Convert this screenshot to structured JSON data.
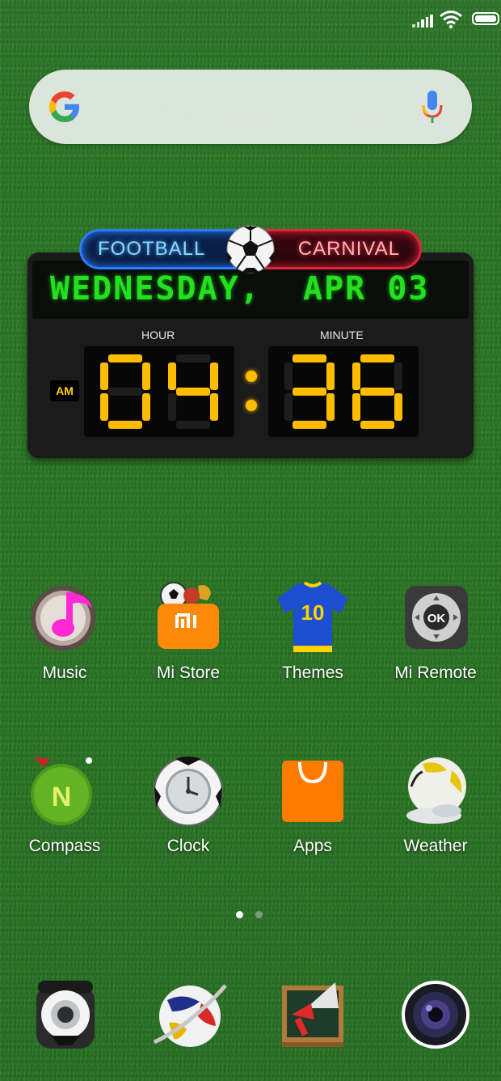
{
  "widget": {
    "banner_left": "FOOTBALL",
    "banner_right": "CARNIVAL",
    "date": "WEDNESDAY,  APR 03",
    "hour_label": "HOUR",
    "minute_label": "MINUTE",
    "ampm": "AM",
    "hour": "04",
    "minute": "36"
  },
  "apps_row1": [
    {
      "label": "Music",
      "icon": "music-icon"
    },
    {
      "label": "Mi Store",
      "icon": "mi-store-icon"
    },
    {
      "label": "Themes",
      "icon": "themes-jersey-icon"
    },
    {
      "label": "Mi Remote",
      "icon": "remote-ok-icon"
    }
  ],
  "apps_row2": [
    {
      "label": "Compass",
      "icon": "compass-icon"
    },
    {
      "label": "Clock",
      "icon": "clock-icon"
    },
    {
      "label": "Apps",
      "icon": "shopping-bag-icon"
    },
    {
      "label": "Weather",
      "icon": "weather-ball-icon"
    }
  ],
  "dock": [
    {
      "icon": "phone-icon"
    },
    {
      "icon": "browser-ball-icon"
    },
    {
      "icon": "messages-board-icon"
    },
    {
      "icon": "camera-icon"
    }
  ],
  "page_indicator": {
    "pages": 2,
    "current": 1
  },
  "colors": {
    "grass": "#2b7a26",
    "scoreboard_digits": "#ffbd00",
    "date_led": "#23e11e",
    "banner_blue": "#2b7dff",
    "banner_red": "#e0243b"
  }
}
